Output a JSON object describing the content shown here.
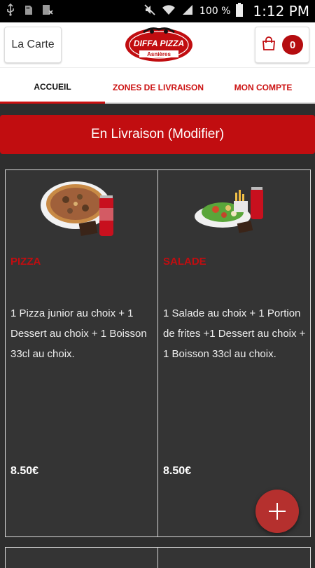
{
  "status_bar": {
    "battery": "100 %",
    "time": "1:12 PM"
  },
  "header": {
    "menu_button": "La Carte",
    "logo_text": "DIFFA PIZZA",
    "logo_subtext": "Asnières",
    "cart_count": "0"
  },
  "tabs": [
    {
      "label": "ACCUEIL"
    },
    {
      "label": "ZONES DE LIVRAISON"
    },
    {
      "label": "MON COMPTE"
    }
  ],
  "delivery_button": "En Livraison (Modifier)",
  "products": [
    {
      "title": "PIZZA",
      "description": "1 Pizza junior au choix  + 1 Dessert au choix  + 1 Boisson 33cl au choix.",
      "price": "8.50€"
    },
    {
      "title": "SALADE",
      "description": "1 Salade au choix  + 1 Portion de frites  +1 Dessert au choix  + 1 Boisson 33cl au choix.",
      "price": "8.50€"
    }
  ],
  "colors": {
    "brand_red": "#c10d10",
    "fab": "#b5302e",
    "card_bg": "#343434"
  },
  "icons": [
    "usb-icon",
    "sd-card-icon",
    "storage-icon",
    "mute-icon",
    "wifi-icon",
    "signal-icon",
    "battery-icon",
    "shopping-bag-icon",
    "plus-icon"
  ]
}
